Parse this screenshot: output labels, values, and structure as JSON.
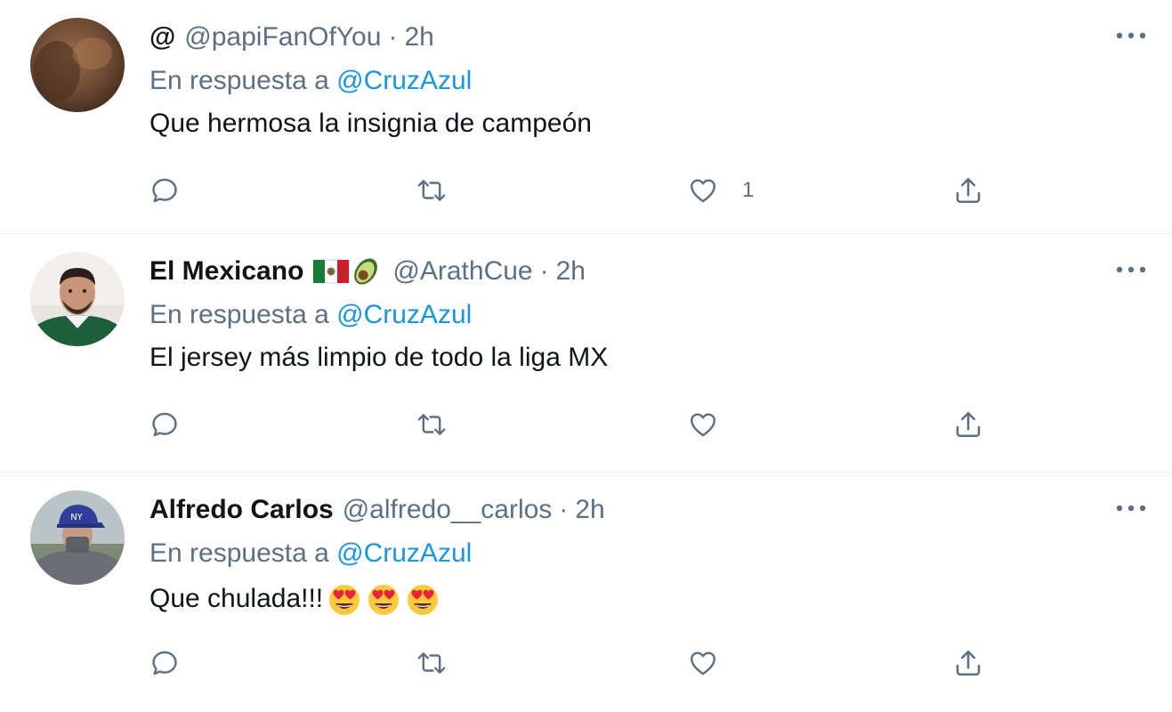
{
  "tweets": [
    {
      "display_name": "@",
      "handle": "@papiFanOfYou",
      "time": "2h",
      "reply_prefix": "En respuesta a",
      "reply_mention": "@CruzAzul",
      "text": "Que hermosa la insignia de campeón",
      "like_count": "1",
      "avatar_icon": "brown-blurred-avatar",
      "avatar_color": "#6e4a33"
    },
    {
      "display_name": "El Mexicano",
      "flags": [
        "mexico-flag-emoji",
        "avocado-emoji"
      ],
      "handle": "@ArathCue",
      "time": "2h",
      "reply_prefix": "En respuesta a",
      "reply_mention": "@CruzAzul",
      "text": "El jersey más limpio de todo la liga MX",
      "like_count": "",
      "avatar_icon": "man-green-jersey-avatar"
    },
    {
      "display_name": "Alfredo Carlos",
      "handle": "@alfredo__carlos",
      "time": "2h",
      "reply_prefix": "En respuesta a",
      "reply_mention": "@CruzAzul",
      "text": "Que chulada!!!",
      "text_emojis": [
        "heart-eyes-emoji",
        "heart-eyes-emoji",
        "heart-eyes-emoji"
      ],
      "like_count": "",
      "avatar_icon": "man-blue-cap-avatar"
    }
  ],
  "separator": "·",
  "icons": {
    "reply": "reply-icon",
    "retweet": "retweet-icon",
    "like": "like-heart-icon",
    "share": "share-icon",
    "more": "more-options-icon"
  },
  "colors": {
    "text_primary": "#0f1419",
    "text_secondary": "#5b7083",
    "mention": "#1b95e0",
    "divider": "#ebeef0"
  }
}
